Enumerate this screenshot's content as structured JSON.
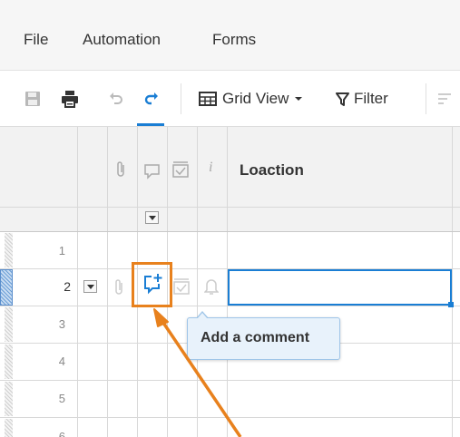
{
  "menubar": {
    "items": [
      "File",
      "Automation",
      "Forms"
    ]
  },
  "toolbar": {
    "grid_view_label": "Grid View",
    "filter_label": "Filter"
  },
  "grid": {
    "column_header": "Loaction",
    "info_column_header": "i",
    "row_numbers": [
      "1",
      "2",
      "3",
      "4",
      "5",
      "6"
    ],
    "selected_row": "2"
  },
  "tooltip": {
    "text": "Add a comment"
  },
  "colors": {
    "accent": "#1a7ed4",
    "highlight": "#e8811d",
    "tooltip_bg": "#e8f2fb"
  },
  "icons": [
    "save-icon",
    "print-icon",
    "undo-icon",
    "redo-icon",
    "grid-view-icon",
    "filter-icon",
    "attachment-icon",
    "comment-icon",
    "add-comment-icon",
    "checklist-icon",
    "bell-icon"
  ]
}
